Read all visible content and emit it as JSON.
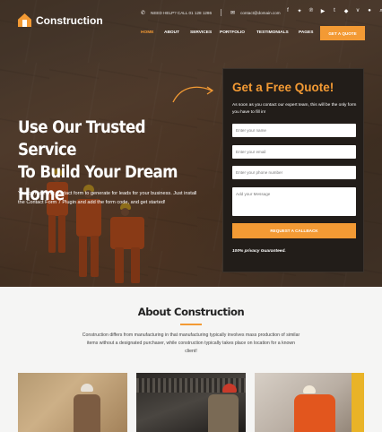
{
  "brand": {
    "name": "Construction",
    "accent": "#f39a34"
  },
  "topbar": {
    "phone": "NEED HELP? CALL 01 128 1286",
    "email": "contact@domain.com",
    "social_icons": [
      "facebook-icon",
      "twitter-icon",
      "pinterest-icon",
      "youtube-icon",
      "tumblr-icon",
      "dropbox-icon",
      "vimeo-icon",
      "flickr-icon",
      "search-icon"
    ]
  },
  "nav": {
    "items": [
      "HOME",
      "ABOUT",
      "SERVICES",
      "PORTFOLIO",
      "TESTIMONIALS",
      "PAGES"
    ],
    "active": "HOME",
    "cta": "GET A QUOTE"
  },
  "hero": {
    "title_lines": [
      "Use Our Trusted Service",
      "To Build Your Dream",
      "Home"
    ],
    "description": "You can use this contact form to generate for leads for your business. Just install the Contact Form 7 Plugin and add the form code, and get started!"
  },
  "quote_form": {
    "title": "Get a Free Quote!",
    "intro": "As soon as you contact our expert team, this will be the only form you have to fill in!",
    "fields": {
      "name": "Enter your name",
      "email": "Enter your email",
      "phone": "Enter your phone number",
      "message": "Add your Message"
    },
    "submit": "REQUEST A CALLBACK",
    "privacy": "100% privacy Guaranteed."
  },
  "about": {
    "title": "About Construction",
    "text": "Construction differs from manufacturing in that manufacturing typically involves mass production of similar items without a designated purchaser, while construction typically takes place on location for a known client!"
  }
}
